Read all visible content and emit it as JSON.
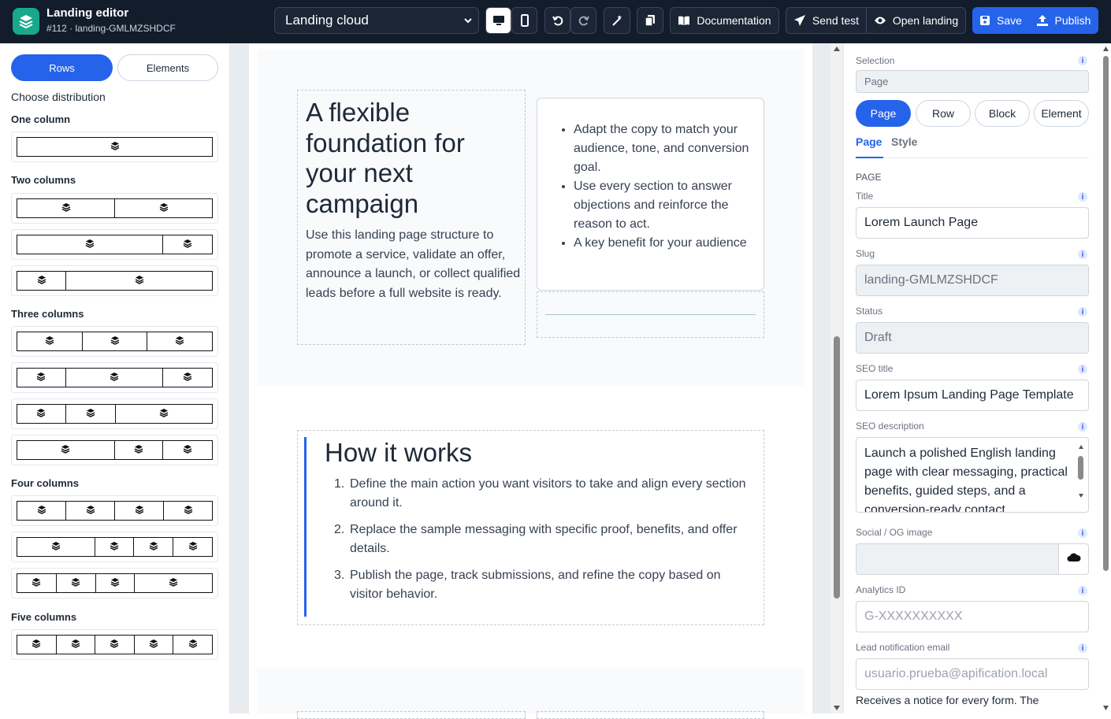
{
  "app": {
    "title": "Landing editor",
    "subtitle": "#112 · landing-GMLMZSHDCF"
  },
  "toolbar": {
    "template_select": "Landing cloud",
    "documentation": "Documentation",
    "send_test": "Send test",
    "open_landing": "Open landing",
    "save": "Save",
    "publish": "Publish"
  },
  "left_panel": {
    "tabs": [
      "Rows",
      "Elements"
    ],
    "choose_label": "Choose distribution",
    "groups": [
      "One column",
      "Two columns",
      "Three columns",
      "Four columns",
      "Five columns"
    ]
  },
  "canvas": {
    "hero_title": "A flexible foundation for your next campaign",
    "hero_text": "Use this landing page structure to promote a service, validate an offer, announce a launch, or collect qualified leads before a full website is ready.",
    "bullets": [
      "Adapt the copy to match your audience, tone, and conversion goal.",
      "Use every section to answer objections and reinforce the reason to act.",
      "A key benefit for your audience"
    ],
    "how_title": "How it works",
    "steps": [
      "Define the main action you want visitors to take and align every section around it.",
      "Replace the sample messaging with specific proof, benefits, and offer details.",
      "Publish the page, track submissions, and refine the copy based on visitor behavior."
    ]
  },
  "right_panel": {
    "selection_label": "Selection",
    "selection_value": "Page",
    "scopes": [
      "Page",
      "Row",
      "Block",
      "Element"
    ],
    "tabs": [
      "Page",
      "Style"
    ],
    "section_heading": "PAGE",
    "fields": {
      "title_label": "Title",
      "title_value": "Lorem Launch Page",
      "slug_label": "Slug",
      "slug_value": "landing-GMLMZSHDCF",
      "status_label": "Status",
      "status_value": "Draft",
      "seo_title_label": "SEO title",
      "seo_title_value": "Lorem Ipsum Landing Page Template",
      "seo_desc_label": "SEO description",
      "seo_desc_value": "Launch a polished English landing page with clear messaging, practical benefits, guided steps, and a conversion-ready contact",
      "og_label": "Social / OG image",
      "analytics_label": "Analytics ID",
      "analytics_placeholder": "G-XXXXXXXXXX",
      "lead_label": "Lead notification email",
      "lead_placeholder": "usuario.prueba@apification.local",
      "lead_help": "Receives a notice for every form. The"
    },
    "info_glyph": "i"
  },
  "colors": {
    "topbar": "#121c2b",
    "primary": "#2563eb",
    "logo": "#1aa88a"
  }
}
